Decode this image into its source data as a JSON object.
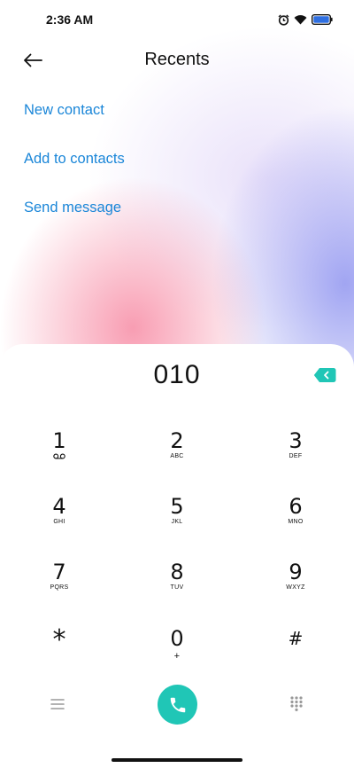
{
  "status": {
    "time": "2:36 AM"
  },
  "header": {
    "title": "Recents"
  },
  "actions": [
    "New contact",
    "Add to contacts",
    "Send message"
  ],
  "dialer": {
    "number": "010",
    "keys": [
      {
        "digit": "1",
        "letters": ""
      },
      {
        "digit": "2",
        "letters": "ABC"
      },
      {
        "digit": "3",
        "letters": "DEF"
      },
      {
        "digit": "4",
        "letters": "GHI"
      },
      {
        "digit": "5",
        "letters": "JKL"
      },
      {
        "digit": "6",
        "letters": "MNO"
      },
      {
        "digit": "7",
        "letters": "PQRS"
      },
      {
        "digit": "8",
        "letters": "TUV"
      },
      {
        "digit": "9",
        "letters": "WXYZ"
      },
      {
        "digit": "*",
        "letters": ""
      },
      {
        "digit": "0",
        "letters": "+"
      },
      {
        "digit": "#",
        "letters": ""
      }
    ]
  },
  "icons": {
    "back": "arrow-left-icon",
    "backspace": "backspace-icon",
    "call": "phone-icon",
    "menu": "menu-icon",
    "keypad": "keypad-icon",
    "voicemail": "voicemail-icon"
  },
  "colors": {
    "accent": "#1a86d8",
    "call": "#20c6b6",
    "backspace": "#20c6b6"
  }
}
